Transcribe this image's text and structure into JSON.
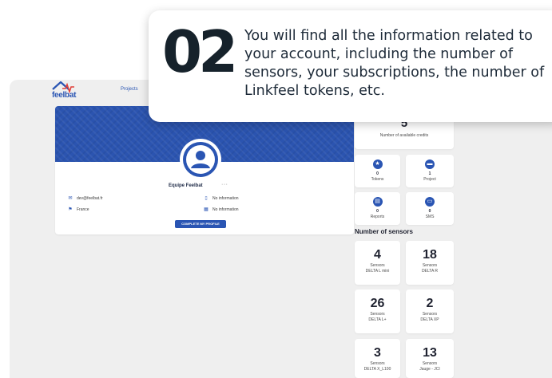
{
  "app": {
    "logo_text": "feelbat",
    "nav_projects": "Projects"
  },
  "profile": {
    "name": "Equipe Feelbat",
    "more": "···",
    "email": "dev@feelbat.fr",
    "country": "France",
    "phone": "No information",
    "company": "No information",
    "cta": "COMPLETE MY PROFILE"
  },
  "stats": {
    "credits_value": "5",
    "credits_label": "Number of available credits",
    "tokens_value": "0",
    "tokens_label": "Tokens",
    "project_value": "1",
    "project_label": "Project",
    "reports_value": "0",
    "reports_label": "Reports",
    "sms_value": "0",
    "sms_label": "SMS"
  },
  "sensors": {
    "title": "Number of sensors",
    "items": [
      {
        "count": "4",
        "label": "Sensors",
        "model": "DELTA L mini"
      },
      {
        "count": "18",
        "label": "Sensors",
        "model": "DELTA R"
      },
      {
        "count": "26",
        "label": "Sensors",
        "model": "DELTA L+"
      },
      {
        "count": "2",
        "label": "Sensors",
        "model": "DELTA XP"
      },
      {
        "count": "3",
        "label": "Sensors",
        "model": "DELTA X_L100"
      },
      {
        "count": "13",
        "label": "Sensors",
        "model": "Jauge - JCI"
      }
    ]
  },
  "callout": {
    "step": "02",
    "text": "You will find all the information related to your account, including the number of sensors, your subscriptions, the number of Linkfeel tokens, etc."
  },
  "colors": {
    "brand_blue": "#2a55b3",
    "accent_red": "#e0413a",
    "dark_text": "#16222b"
  },
  "icons": [
    "house-logo-icon",
    "user-avatar-icon",
    "email-icon",
    "flag-icon",
    "phone-icon",
    "building-icon",
    "star-icon",
    "folder-icon",
    "report-icon",
    "sms-icon"
  ]
}
